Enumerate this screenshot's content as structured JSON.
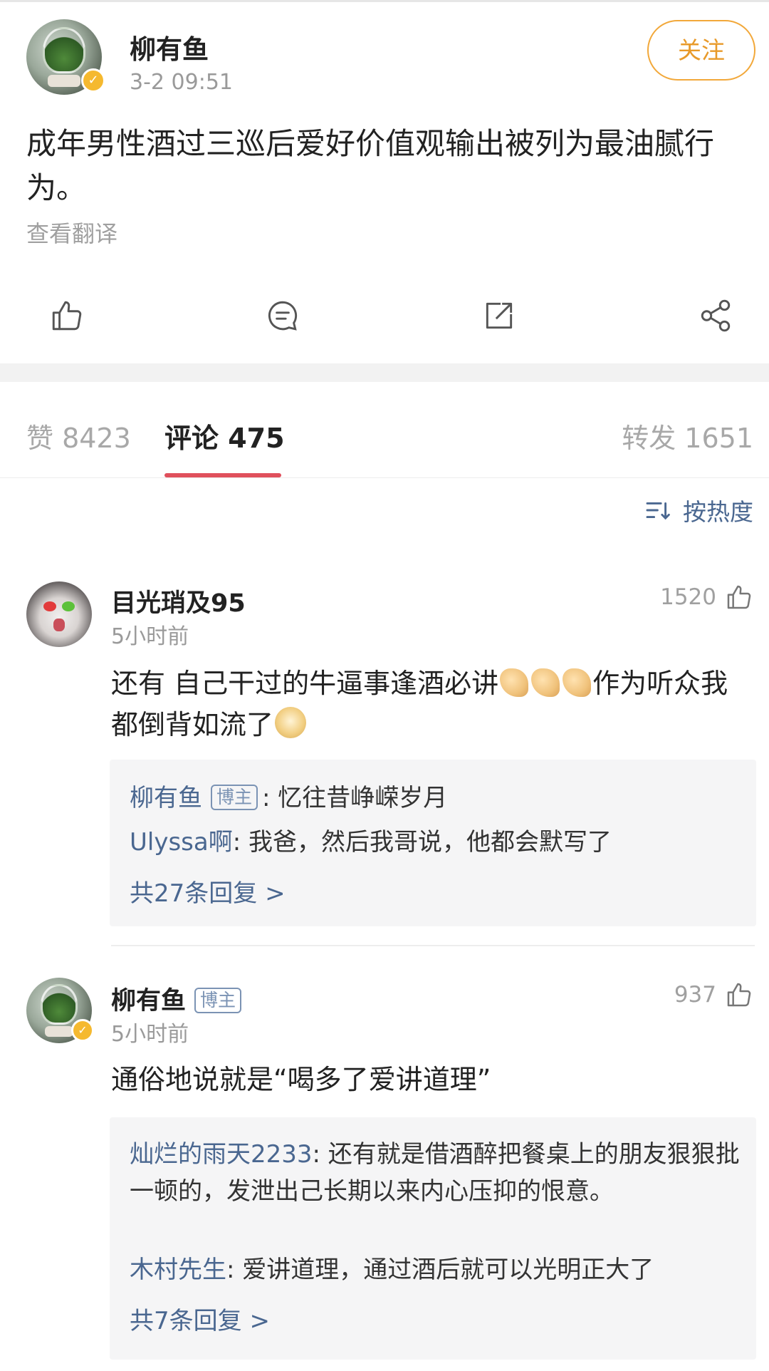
{
  "post": {
    "author": "柳有鱼",
    "time": "3-2 09:51",
    "follow_label": "关注",
    "text": "成年男性酒过三巡后爱好价值观输出被列为最油腻行为。",
    "translate_label": "查看翻译"
  },
  "tabs": {
    "likes": "赞 8423",
    "comments": "评论 475",
    "reposts": "转发 1651"
  },
  "sort_label": "按热度",
  "comments": [
    {
      "name": "目光琑及95",
      "time": "5小时前",
      "likes": "1520",
      "text_part1": "还有 自己干过的牛逼事逢酒必讲",
      "text_part2": "作为听众我都倒背如流了",
      "replies": [
        {
          "name": "柳有鱼",
          "badge": "博主",
          "text": ": 忆往昔峥嵘岁月"
        },
        {
          "name": "Ulyssa啊",
          "text": ": 我爸，然后我哥说，他都会默写了"
        }
      ],
      "more": "共27条回复 >"
    },
    {
      "name": "柳有鱼",
      "badge": "博主",
      "time": "5小时前",
      "likes": "937",
      "text": "通俗地说就是“喝多了爱讲道理”",
      "replies": [
        {
          "name": "灿烂的雨天2233",
          "text": ": 还有就是借酒醉把餐桌上的朋友狠狠批一顿的，发泄出己长期以来内心压抑的恨意。"
        },
        {
          "name": "木村先生",
          "text": ": 爱讲道理，通过酒后就可以光明正大了"
        }
      ],
      "more": "共7条回复 >"
    }
  ],
  "colors": {
    "accent_follow": "#e89a2a",
    "link_blue": "#4a6790",
    "tab_underline": "#e0505c",
    "verified_badge": "#f5b92f"
  },
  "icons": {
    "verified": "✓"
  }
}
